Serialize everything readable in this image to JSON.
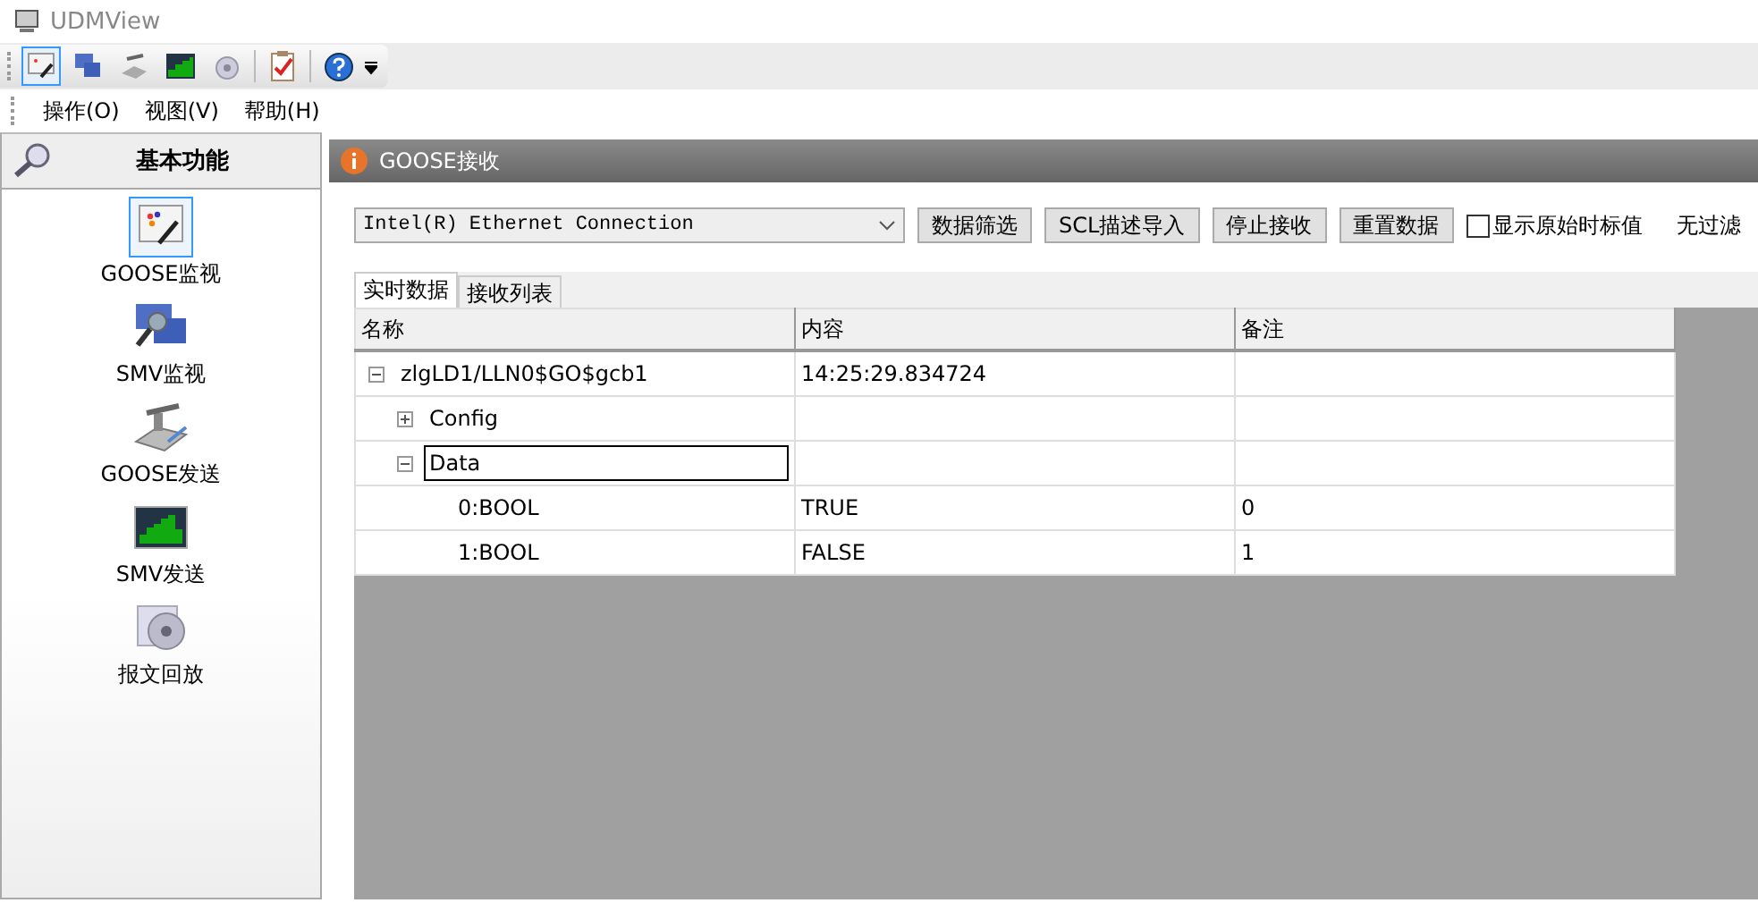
{
  "window": {
    "title": "UDMView"
  },
  "menu": [
    {
      "label": "操作(O)"
    },
    {
      "label": "视图(V)"
    },
    {
      "label": "帮助(H)"
    }
  ],
  "sidebar": {
    "title": "基本功能",
    "items": [
      {
        "label": "GOOSE监视",
        "kind": "monitor",
        "selected": true
      },
      {
        "label": "SMV监视",
        "kind": "scope",
        "selected": false
      },
      {
        "label": "GOOSE发送",
        "kind": "send",
        "selected": false
      },
      {
        "label": "SMV发送",
        "kind": "chart",
        "selected": false
      },
      {
        "label": "报文回放",
        "kind": "replay",
        "selected": false
      }
    ]
  },
  "panel": {
    "title": "GOOSE接收",
    "adapter": {
      "value": "Intel(R) Ethernet Connection"
    },
    "buttons": [
      "数据筛选",
      "SCL描述导入",
      "停止接收",
      "重置数据"
    ],
    "raw_timestamp": {
      "label": "显示原始时标值",
      "checked": false
    },
    "filter_status": "无过滤",
    "tabs": [
      {
        "label": "实时数据",
        "selected": true
      },
      {
        "label": "接收列表",
        "selected": false
      }
    ],
    "table": {
      "columns": [
        "名称",
        "内容",
        "备注"
      ],
      "rows": [
        {
          "name": "zlgLD1/LLN0$GO$gcb1",
          "content": "14:25:29.834724",
          "expanded": true,
          "focused": false,
          "children": [
            {
              "name": "Config",
              "expanded": false,
              "focused": false
            },
            {
              "name": "Data",
              "expanded": true,
              "focused": true,
              "children": [
                {
                  "name": "0:BOOL",
                  "content": "TRUE",
                  "note": "0",
                  "focused": false
                },
                {
                  "name": "1:BOOL",
                  "content": "FALSE",
                  "note": "1",
                  "focused": false
                }
              ]
            }
          ]
        }
      ]
    }
  }
}
